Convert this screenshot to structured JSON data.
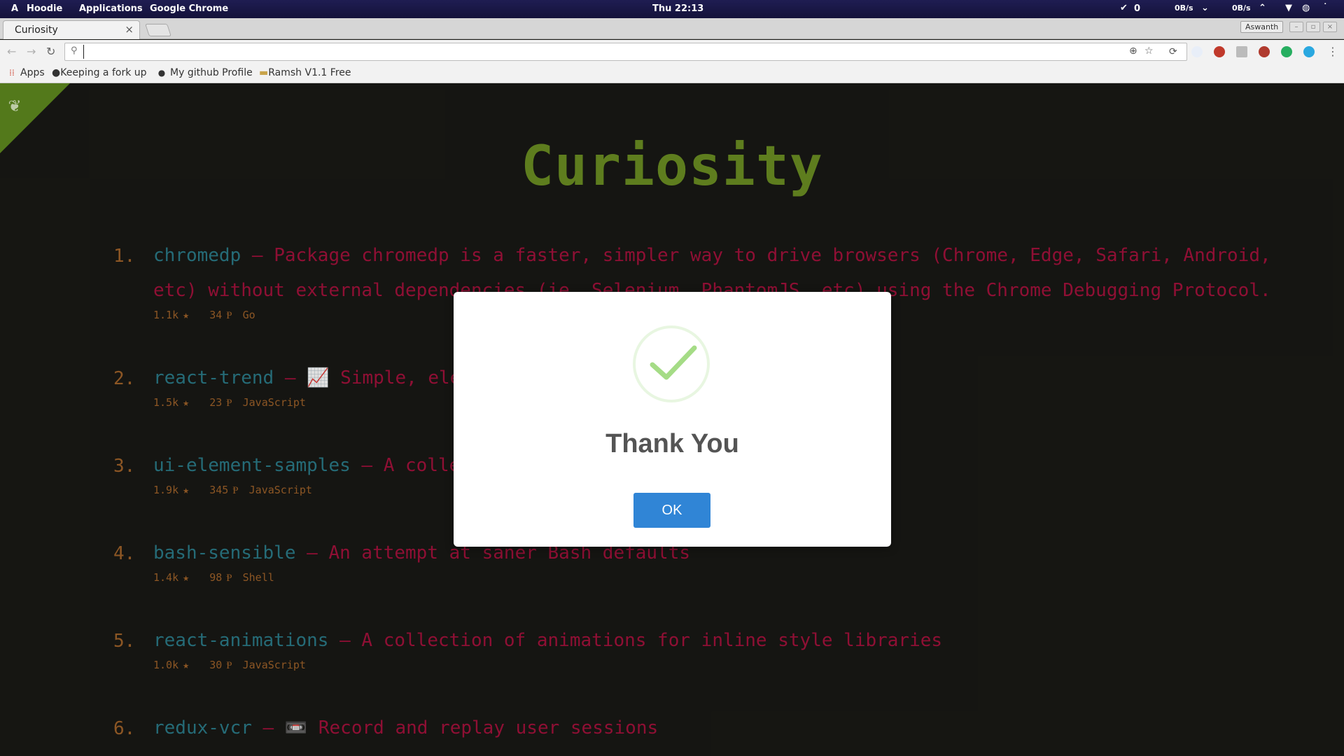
{
  "topbar": {
    "activities_glyph": "A",
    "user": "Hoodie",
    "applications": "Applications",
    "current_app": "Google Chrome",
    "clock": "Thu 22:13",
    "updates_count": "0",
    "net_down": "0B/s",
    "net_up": "0B/s"
  },
  "browser": {
    "tab_title": "Curiosity",
    "tab_close": "×",
    "profile_name": "Aswanth",
    "address_value": ""
  },
  "bookmarks": [
    {
      "label": "Apps",
      "icon": "apps-grid-icon"
    },
    {
      "label": "Keeping a fork up",
      "icon": "github-icon"
    },
    {
      "label": "My github Profile",
      "icon": "github-icon"
    },
    {
      "label": "Ramsh V1.1 Free",
      "icon": "folder-icon"
    }
  ],
  "page": {
    "title": "Curiosity",
    "repos": [
      {
        "num": "1.",
        "name": "chromedp",
        "desc": " – Package chromedp is a faster, simpler way to drive browsers (Chrome, Edge, Safari, Android, etc) without external dependencies (ie, Selenium, PhantomJS, etc) using the Chrome Debugging Protocol.",
        "stars": "1.1k",
        "forks": "34",
        "lang": "Go"
      },
      {
        "num": "2.",
        "name": "react-trend",
        "desc": " – 📈 Simple, eleg",
        "stars": "1.5k",
        "forks": "23",
        "lang": "JavaScript"
      },
      {
        "num": "3.",
        "name": "ui-element-samples",
        "desc": " – A collec",
        "stars": "1.9k",
        "forks": "345",
        "lang": "JavaScript"
      },
      {
        "num": "4.",
        "name": "bash-sensible",
        "desc": " – An attempt at saner Bash defaults",
        "stars": "1.4k",
        "forks": "98",
        "lang": "Shell"
      },
      {
        "num": "5.",
        "name": "react-animations",
        "desc": " – A collection of animations for inline style libraries",
        "stars": "1.0k",
        "forks": "30",
        "lang": "JavaScript"
      },
      {
        "num": "6.",
        "name": "redux-vcr",
        "desc": " – 📼 Record and replay user sessions",
        "stars": "",
        "forks": "",
        "lang": ""
      }
    ]
  },
  "modal": {
    "title": "Thank You",
    "ok_label": "OK",
    "success_color": "#a5dc86",
    "button_color": "#3085d6"
  },
  "colors": {
    "title": "#6b8f23",
    "repo_name": "#2b7a88",
    "repo_desc": "#a3123c",
    "meta": "#a0622a",
    "background": "#191915"
  }
}
